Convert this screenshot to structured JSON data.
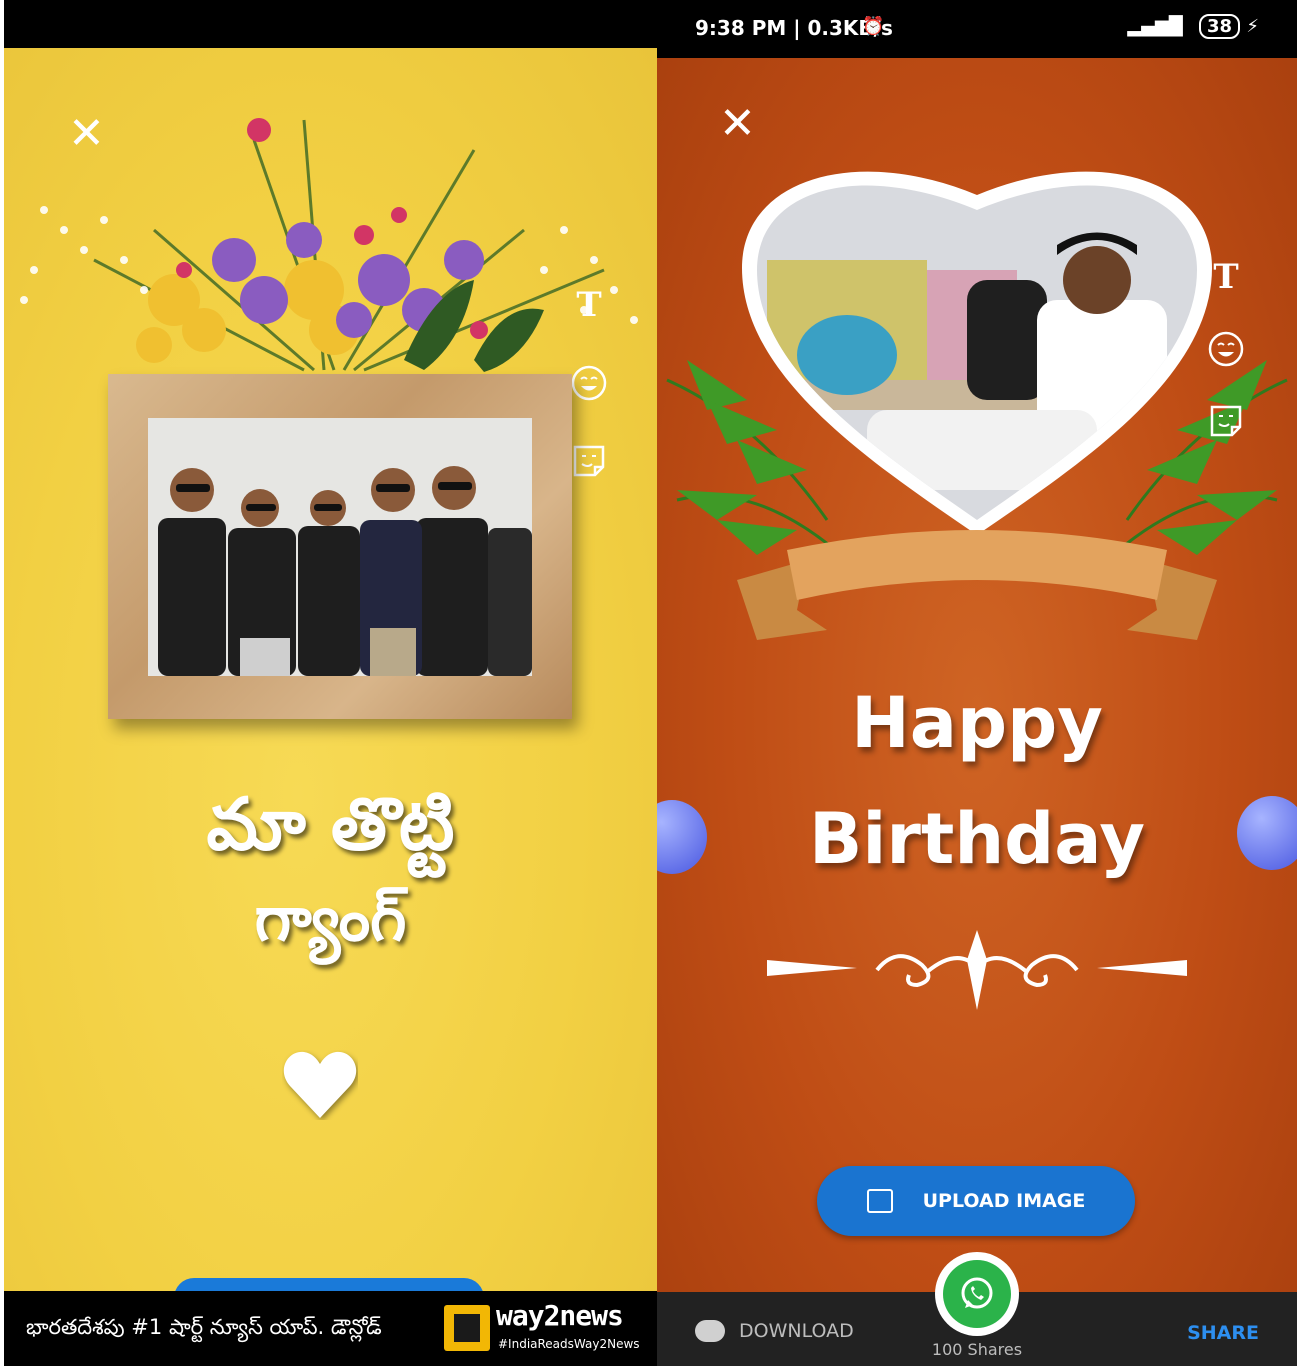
{
  "left": {
    "title_line1": "మా తొట్టి",
    "title_line2": "గ్యాంగ్",
    "footer_text": "భారతదేశపు #1 షార్ట్ న్యూస్ యాప్. డౌన్లోడ్",
    "brand_name": "way2news",
    "brand_tag": "#IndiaReadsWay2News",
    "icons": [
      "close-icon",
      "text-icon",
      "emoji-icon",
      "sticker-icon",
      "heart-icon"
    ]
  },
  "right": {
    "status": {
      "time": "9:38 PM | 0.3KB/s",
      "battery": "38"
    },
    "greeting_line1": "Happy",
    "greeting_line2": "Birthday",
    "upload_label": "UPLOAD IMAGE",
    "download_label": "DOWNLOAD",
    "share_label": "SHARE",
    "shares_count": "100 Shares",
    "icons": [
      "close-icon",
      "text-icon",
      "emoji-icon",
      "sticker-icon",
      "whatsapp-icon",
      "download-icon",
      "image-icon"
    ]
  },
  "colors": {
    "left_bg": "#f2d043",
    "right_bg": "#c4561a",
    "upload_button": "#1a74d0",
    "share_text": "#2d8ff0",
    "whatsapp": "#2bb34a"
  }
}
